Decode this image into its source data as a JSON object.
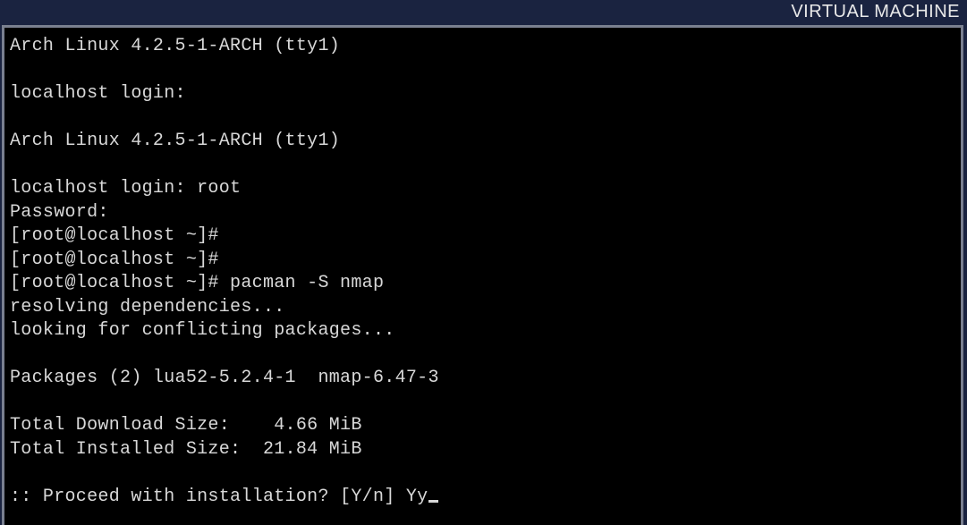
{
  "vm_label": "VIRTUAL MACHINE",
  "terminal": {
    "lines": [
      "Arch Linux 4.2.5-1-ARCH (tty1)",
      "",
      "localhost login:",
      "",
      "Arch Linux 4.2.5-1-ARCH (tty1)",
      "",
      "localhost login: root",
      "Password:",
      "[root@localhost ~]#",
      "[root@localhost ~]#",
      "[root@localhost ~]# pacman -S nmap",
      "resolving dependencies...",
      "looking for conflicting packages...",
      "",
      "Packages (2) lua52-5.2.4-1  nmap-6.47-3",
      "",
      "Total Download Size:    4.66 MiB",
      "Total Installed Size:  21.84 MiB",
      "",
      ":: Proceed with installation? [Y/n] Yy"
    ]
  }
}
